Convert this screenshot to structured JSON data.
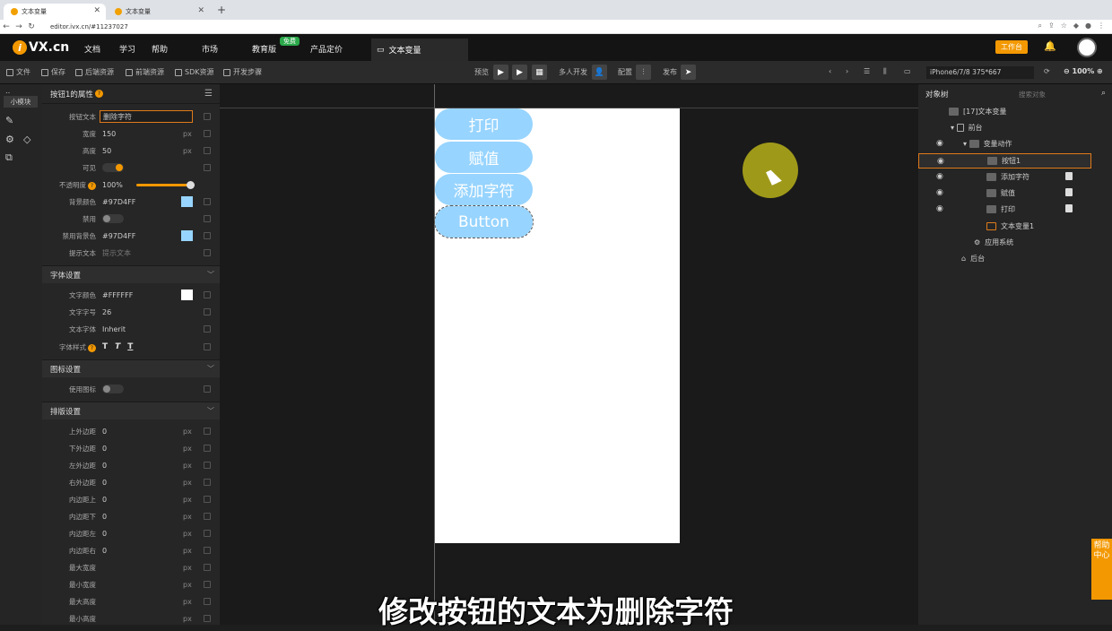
{
  "browser": {
    "tabs": [
      {
        "label": "文本变量",
        "active": true
      },
      {
        "label": "文本变量",
        "active": false
      }
    ],
    "url": "editor.ivx.cn/#11237027"
  },
  "app": {
    "logo_text": "VX.cn",
    "nav": [
      "文档",
      "学习",
      "帮助",
      "市场",
      "教育版",
      "产品定价"
    ],
    "free_badge": "免费",
    "open_tab": "文本变量",
    "workbench_label": "工作台"
  },
  "toolbar": {
    "left": [
      "文件",
      "保存",
      "后端资源",
      "前端资源",
      "SDK资源",
      "开发步骤"
    ],
    "preview": "预览",
    "multi_dev": "多人开发",
    "config": "配置",
    "publish": "发布",
    "device": "iPhone6/7/8 375*667",
    "zoom": "100%"
  },
  "left_strip": {
    "module_btn": "小模块"
  },
  "props": {
    "header": "按钮1的属性",
    "rows": {
      "text": {
        "label": "按钮文本",
        "value": "删除字符"
      },
      "width": {
        "label": "宽度",
        "value": "150",
        "unit": "px"
      },
      "height": {
        "label": "高度",
        "value": "50",
        "unit": "px"
      },
      "visible": {
        "label": "可见"
      },
      "opacity": {
        "label": "不透明度",
        "value": "100",
        "unit": "%"
      },
      "bg": {
        "label": "背景颜色",
        "value": "#97D4FF"
      },
      "disabled": {
        "label": "禁用"
      },
      "disabled_bg": {
        "label": "禁用背景色",
        "value": "#97D4FF"
      },
      "tip": {
        "label": "提示文本",
        "placeholder": "提示文本"
      }
    },
    "font_section": "字体设置",
    "font": {
      "color": {
        "label": "文字颜色",
        "value": "#FFFFFF"
      },
      "size": {
        "label": "文字字号",
        "value": "26"
      },
      "family": {
        "label": "文本字体",
        "value": "Inherit"
      },
      "style": {
        "label": "字体样式"
      }
    },
    "icon_section": "图标设置",
    "icon_use": "使用图标",
    "layout_section": "排版设置",
    "layout": [
      {
        "label": "上外边距",
        "value": "0",
        "unit": "px"
      },
      {
        "label": "下外边距",
        "value": "0",
        "unit": "px"
      },
      {
        "label": "左外边距",
        "value": "0",
        "unit": "px"
      },
      {
        "label": "右外边距",
        "value": "0",
        "unit": "px"
      },
      {
        "label": "内边距上",
        "value": "0",
        "unit": "px"
      },
      {
        "label": "内边距下",
        "value": "0",
        "unit": "px"
      },
      {
        "label": "内边距左",
        "value": "0",
        "unit": "px"
      },
      {
        "label": "内边距右",
        "value": "0",
        "unit": "px"
      },
      {
        "label": "最大宽度",
        "value": "",
        "unit": "px"
      },
      {
        "label": "最小宽度",
        "value": "",
        "unit": "px"
      },
      {
        "label": "最大高度",
        "value": "",
        "unit": "px"
      },
      {
        "label": "最小高度",
        "value": "",
        "unit": "px"
      }
    ]
  },
  "canvas": {
    "buttons": [
      "打印",
      "赋值",
      "添加字符",
      "Button"
    ]
  },
  "tree": {
    "header": "对象树",
    "search_placeholder": "搜索对象",
    "nodes": {
      "root": "[17]文本变量",
      "front": "前台",
      "action": "变量动作",
      "btn1": "按钮1",
      "add": "添加字符",
      "assign": "赋值",
      "print": "打印",
      "var": "文本变量1",
      "sys": "应用系统",
      "back": "后台"
    }
  },
  "help": "帮助中心",
  "subtitle": "修改按钮的文本为删除字符"
}
